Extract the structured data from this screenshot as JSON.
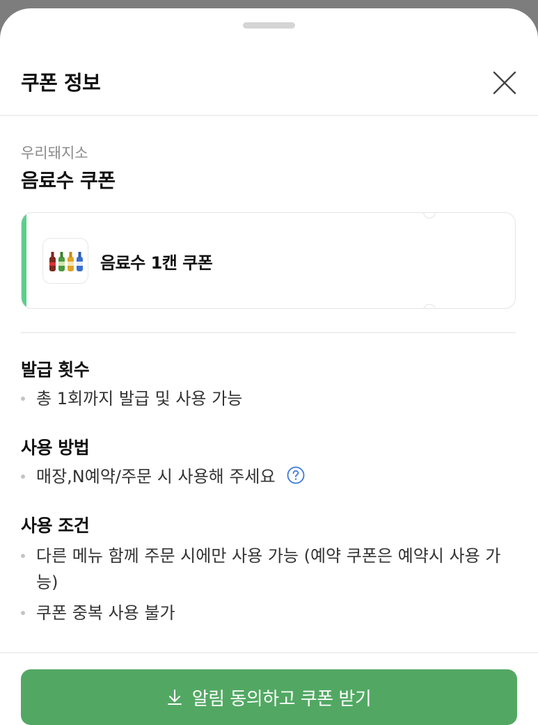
{
  "header": {
    "title": "쿠폰 정보"
  },
  "coupon": {
    "store": "우리돼지소",
    "title": "음료수 쿠폰",
    "ticket_label": "음료수 1캔 쿠폰",
    "accent_color": "#5dcd8e"
  },
  "sections": [
    {
      "title": "발급 횟수",
      "items": [
        "총 1회까지 발급 및 사용 가능"
      ]
    },
    {
      "title": "사용 방법",
      "items": [
        "매장,N예약/주문 시 사용해 주세요"
      ]
    },
    {
      "title": "사용 조건",
      "items": [
        "다른 메뉴 함께 주문 시에만 사용 가능 (예약 쿠폰은 예약시 사용 가능)",
        "쿠폰 중복 사용 불가"
      ]
    }
  ],
  "cta": {
    "label": "알림 동의하고 쿠폰 받기",
    "color": "#52a863"
  },
  "icons": [
    "grabber-handle",
    "close-icon",
    "product-thumbnail-bottles",
    "help-icon",
    "download-icon"
  ]
}
